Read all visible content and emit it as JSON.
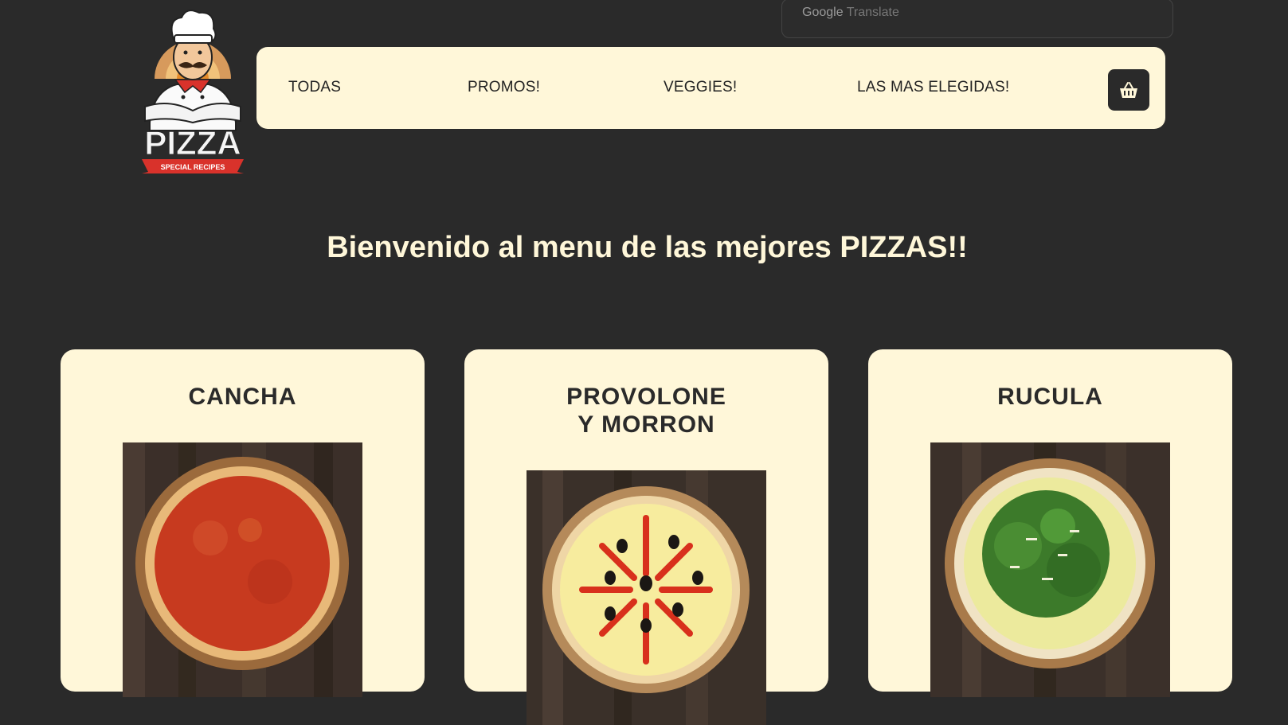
{
  "translate": {
    "google": "Google",
    "translate": "Translate"
  },
  "logo": {
    "word": "PIZZA",
    "ribbon": "SPECIAL RECIPES"
  },
  "nav": {
    "items": [
      "TODAS",
      "PROMOS!",
      "VEGGIES!",
      "LAS MAS ELEGIDAS!"
    ],
    "cart_icon": "basket-icon"
  },
  "hero": {
    "title": "Bienvenido al menu de las mejores PIZZAS!!"
  },
  "products": [
    {
      "name": "CANCHA",
      "image": "pizza-cancha-image"
    },
    {
      "name": "PROVOLONE Y MORRON",
      "image": "pizza-provolone-morron-image"
    },
    {
      "name": "RUCULA",
      "image": "pizza-rucula-image"
    }
  ],
  "colors": {
    "background": "#2a2a2a",
    "cream": "#fff7d9",
    "text_dark": "#222222"
  }
}
